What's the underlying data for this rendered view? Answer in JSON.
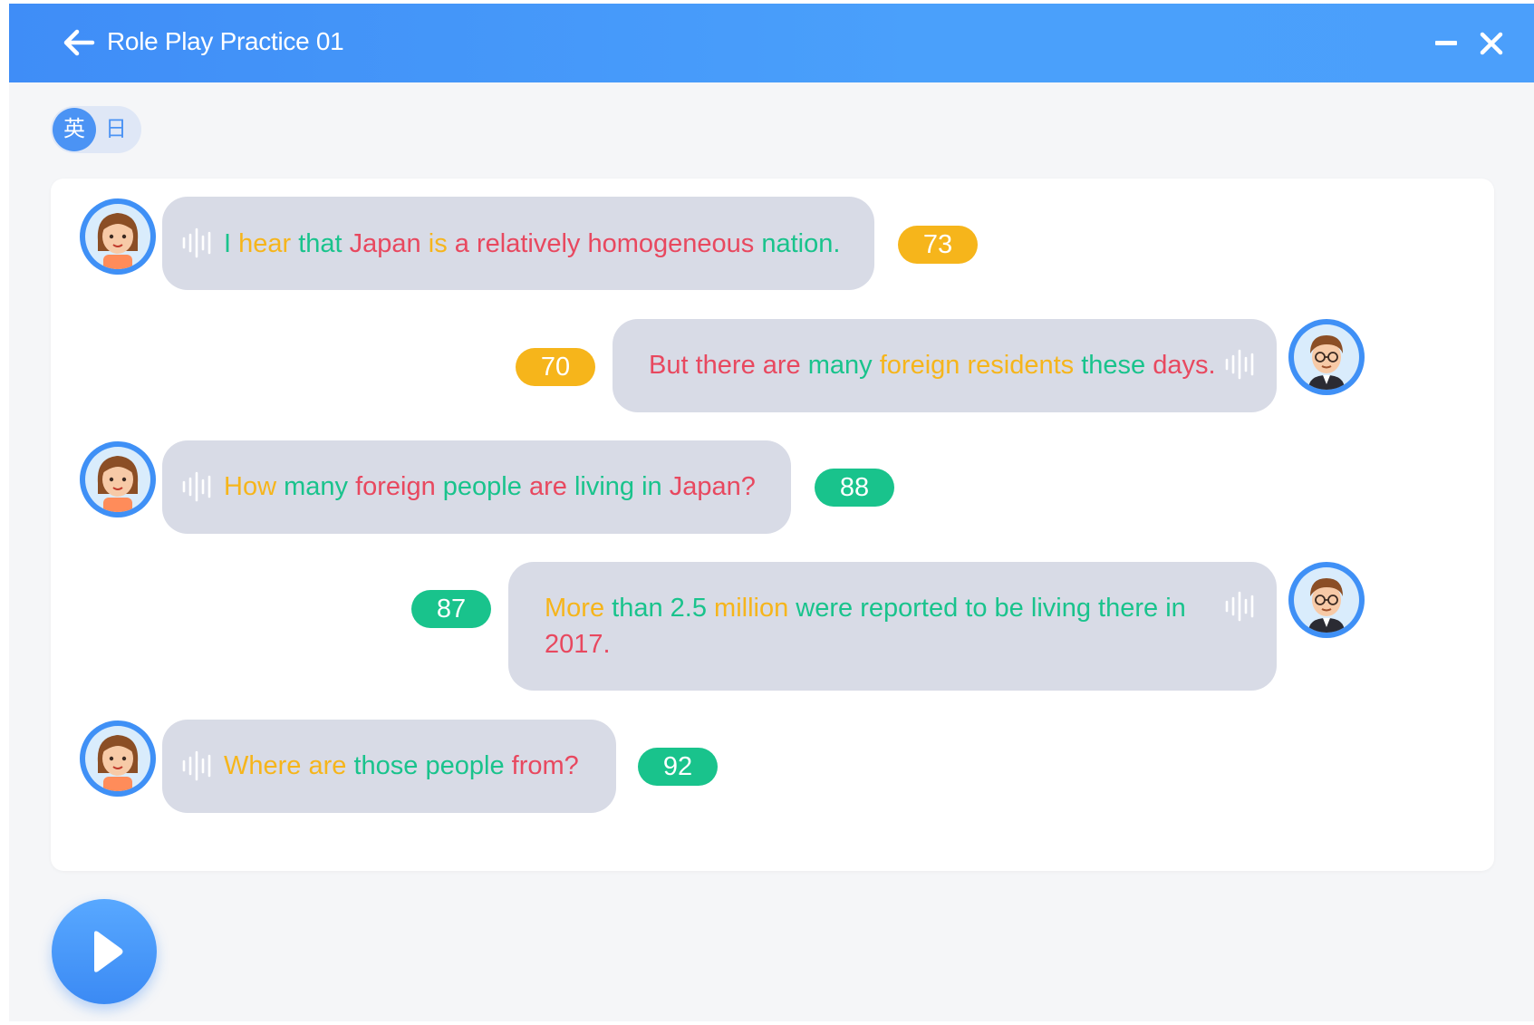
{
  "window": {
    "title": "Role Play Practice 01"
  },
  "language_toggle": {
    "english_label": "英",
    "japanese_label": "日",
    "active": "english"
  },
  "messages": [
    {
      "speaker": "female",
      "score": "73",
      "score_color": "#f6b51b",
      "words": [
        {
          "t": "I",
          "c": "#19c38c"
        },
        {
          "t": "hear",
          "c": "#f6b51b"
        },
        {
          "t": "that",
          "c": "#19c38c"
        },
        {
          "t": "Japan",
          "c": "#e8485f"
        },
        {
          "t": "is",
          "c": "#f6b51b"
        },
        {
          "t": "a",
          "c": "#e8485f"
        },
        {
          "t": "relatively",
          "c": "#e8485f"
        },
        {
          "t": "homogeneous",
          "c": "#e8485f"
        },
        {
          "t": "nation.",
          "c": "#19c38c"
        }
      ]
    },
    {
      "speaker": "male",
      "score": "70",
      "score_color": "#f6b51b",
      "words": [
        {
          "t": "But",
          "c": "#e8485f"
        },
        {
          "t": "there",
          "c": "#e8485f"
        },
        {
          "t": "are",
          "c": "#e8485f"
        },
        {
          "t": "many",
          "c": "#19c38c"
        },
        {
          "t": "foreign",
          "c": "#f6b51b"
        },
        {
          "t": "residents",
          "c": "#f6b51b"
        },
        {
          "t": "these",
          "c": "#19c38c"
        },
        {
          "t": "days.",
          "c": "#e8485f"
        }
      ]
    },
    {
      "speaker": "female",
      "score": "88",
      "score_color": "#19c38c",
      "words": [
        {
          "t": "How",
          "c": "#f6b51b"
        },
        {
          "t": "many",
          "c": "#19c38c"
        },
        {
          "t": "foreign",
          "c": "#e8485f"
        },
        {
          "t": "people",
          "c": "#19c38c"
        },
        {
          "t": "are",
          "c": "#e8485f"
        },
        {
          "t": "living",
          "c": "#19c38c"
        },
        {
          "t": "in",
          "c": "#19c38c"
        },
        {
          "t": "Japan?",
          "c": "#e8485f"
        }
      ]
    },
    {
      "speaker": "male",
      "score": "87",
      "score_color": "#19c38c",
      "line1": [
        {
          "t": "More",
          "c": "#f6b51b"
        },
        {
          "t": "than",
          "c": "#19c38c"
        },
        {
          "t": "2.5",
          "c": "#19c38c"
        },
        {
          "t": "million",
          "c": "#f6b51b"
        },
        {
          "t": "were",
          "c": "#19c38c"
        },
        {
          "t": "reported",
          "c": "#19c38c"
        },
        {
          "t": "to",
          "c": "#19c38c"
        },
        {
          "t": "be",
          "c": "#19c38c"
        },
        {
          "t": "living",
          "c": "#19c38c"
        },
        {
          "t": "there",
          "c": "#19c38c"
        },
        {
          "t": "in",
          "c": "#19c38c"
        }
      ],
      "line2": [
        {
          "t": "2017.",
          "c": "#e8485f"
        }
      ]
    },
    {
      "speaker": "female",
      "score": "92",
      "score_color": "#19c38c",
      "words": [
        {
          "t": "Where",
          "c": "#f6b51b"
        },
        {
          "t": "are",
          "c": "#f6b51b"
        },
        {
          "t": "those",
          "c": "#19c38c"
        },
        {
          "t": "people",
          "c": "#19c38c"
        },
        {
          "t": "from?",
          "c": "#e8485f"
        }
      ]
    }
  ],
  "icons": {
    "back": "arrow-left-icon",
    "minimize": "minimize-icon",
    "close": "close-icon",
    "audio": "audio-wave-icon",
    "play": "play-icon"
  }
}
